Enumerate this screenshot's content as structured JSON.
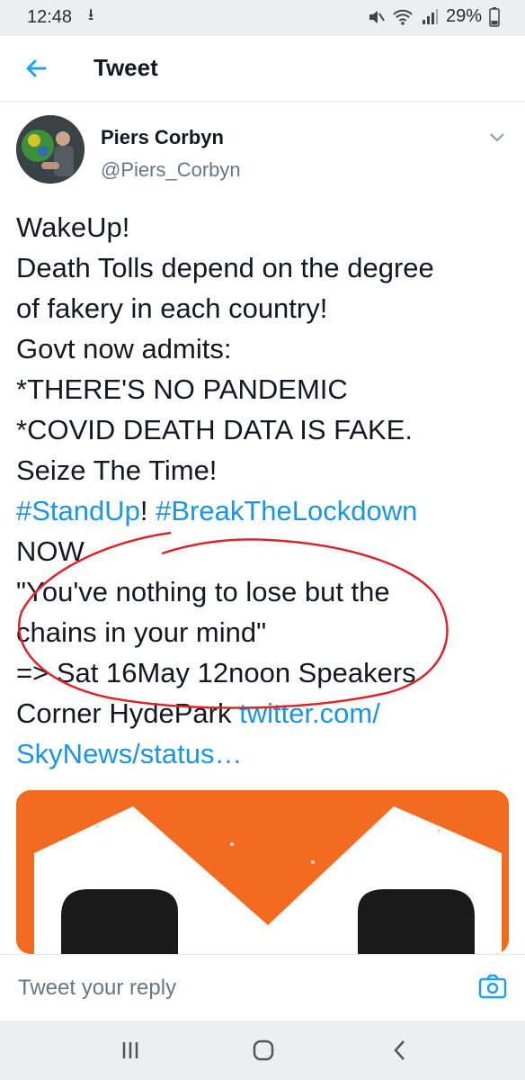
{
  "status_bar": {
    "time": "12:48",
    "download_glyph": "⭳",
    "battery_percent": "29%",
    "icons": [
      "mute-icon",
      "wifi-icon",
      "signal-icon",
      "battery-icon"
    ]
  },
  "app_bar": {
    "title": "Tweet",
    "back_icon": "back-arrow-icon"
  },
  "tweet": {
    "author_name": "Piers Corbyn",
    "author_handle": "@Piers_Corbyn",
    "menu_icon": "chevron-down-icon",
    "lines": [
      {
        "text": "WakeUp!"
      },
      {
        "text": "Death Tolls depend on the degree"
      },
      {
        "text": "of fakery in each country!"
      },
      {
        "text": "Govt now admits:"
      },
      {
        "text": "*THERE'S NO PANDEMIC"
      },
      {
        "text": "*COVID DEATH DATA IS FAKE."
      },
      {
        "text": "Seize The Time!"
      },
      {
        "hashtag1": "#StandUp",
        "sep": "! ",
        "hashtag2": "#BreakTheLockdown"
      },
      {
        "text": "NOW"
      },
      {
        "text": "\"You've nothing to lose but the"
      },
      {
        "text": "chains in your mind\""
      },
      {
        "text": "=> Sat 16May 12noon Speakers"
      },
      {
        "prefix": "Corner HydePark ",
        "link": "twitter.com/"
      },
      {
        "link": "SkyNews/status…"
      }
    ],
    "link_color": "#1b95e0",
    "annotation_color": "#d9262b",
    "media_colors": {
      "background": "#f26b21",
      "shape": "#ffffff",
      "fists": "#1a1a1a"
    }
  },
  "reply": {
    "placeholder": "Tweet your reply",
    "camera_icon": "camera-icon"
  },
  "nav_bar": {
    "icons": [
      "recent-apps-icon",
      "home-icon",
      "back-icon"
    ]
  }
}
